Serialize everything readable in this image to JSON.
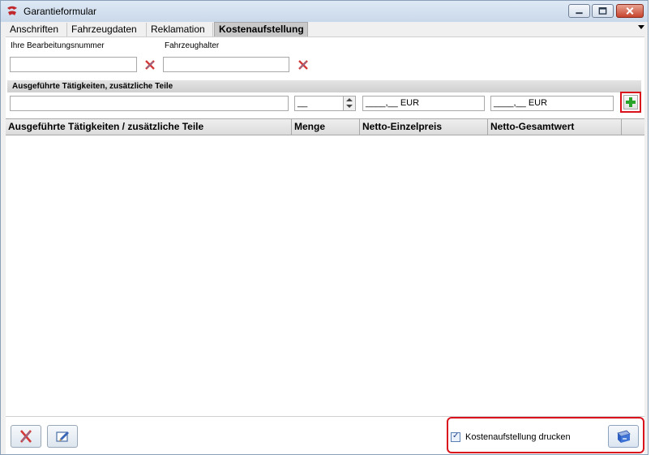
{
  "window": {
    "title": "Garantieformular"
  },
  "tabs": [
    {
      "label": "Anschriften"
    },
    {
      "label": "Fahrzeugdaten"
    },
    {
      "label": "Reklamation"
    },
    {
      "label": "Kostenaufstellung"
    }
  ],
  "form": {
    "bearbeitungsnummer_label": "Ihre Bearbeitungsnummer",
    "bearbeitungsnummer_value": "",
    "fahrzeughalter_label": "Fahrzeughalter",
    "fahrzeughalter_value": ""
  },
  "section": {
    "title": "Ausgeführte Tätigkeiten, zusätzliche Teile",
    "taetigkeit_value": "",
    "menge_value": "__",
    "einzelpreis_value": "____,__ EUR",
    "gesamtwert_value": "____,__ EUR"
  },
  "table": {
    "columns": [
      "Ausgeführte Tätigkeiten / zusätzliche Teile",
      "Menge",
      "Netto-Einzelpreis",
      "Netto-Gesamtwert",
      ""
    ],
    "rows": []
  },
  "footer": {
    "print_checkbox_label": "Kostenaufstellung drucken",
    "print_checked": true
  },
  "colors": {
    "highlight": "#d9121c",
    "add_icon": "#2aa52a"
  }
}
